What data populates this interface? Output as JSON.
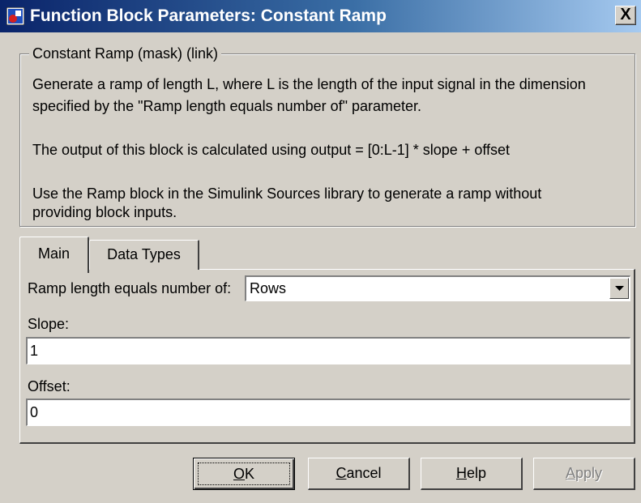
{
  "window": {
    "title": "Function Block Parameters: Constant Ramp",
    "close_label": "X"
  },
  "description": {
    "group_title": "Constant Ramp (mask) (link)",
    "lines": [
      "Generate a ramp of length L, where L is the length of the input signal in the dimension",
      "specified by the \"Ramp length equals number of\" parameter.",
      "The output of this block is calculated using output = [0:L-1] * slope + offset",
      "Use the Ramp block in the Simulink Sources library to generate a ramp without",
      "providing block inputs."
    ]
  },
  "tabs": [
    {
      "label": "Main",
      "active": true
    },
    {
      "label": "Data Types",
      "active": false
    }
  ],
  "params": {
    "ramp_length_label": "Ramp length equals number of:",
    "ramp_length_value": "Rows",
    "slope_label": "Slope:",
    "slope_value": "1",
    "offset_label": "Offset:",
    "offset_value": "0"
  },
  "buttons": {
    "ok": {
      "mnemonic": "O",
      "rest": "K"
    },
    "cancel": {
      "mnemonic": "C",
      "rest": "ancel"
    },
    "help": {
      "mnemonic": "H",
      "rest": "elp"
    },
    "apply": {
      "mnemonic": "A",
      "rest": "pply",
      "disabled": true
    }
  }
}
